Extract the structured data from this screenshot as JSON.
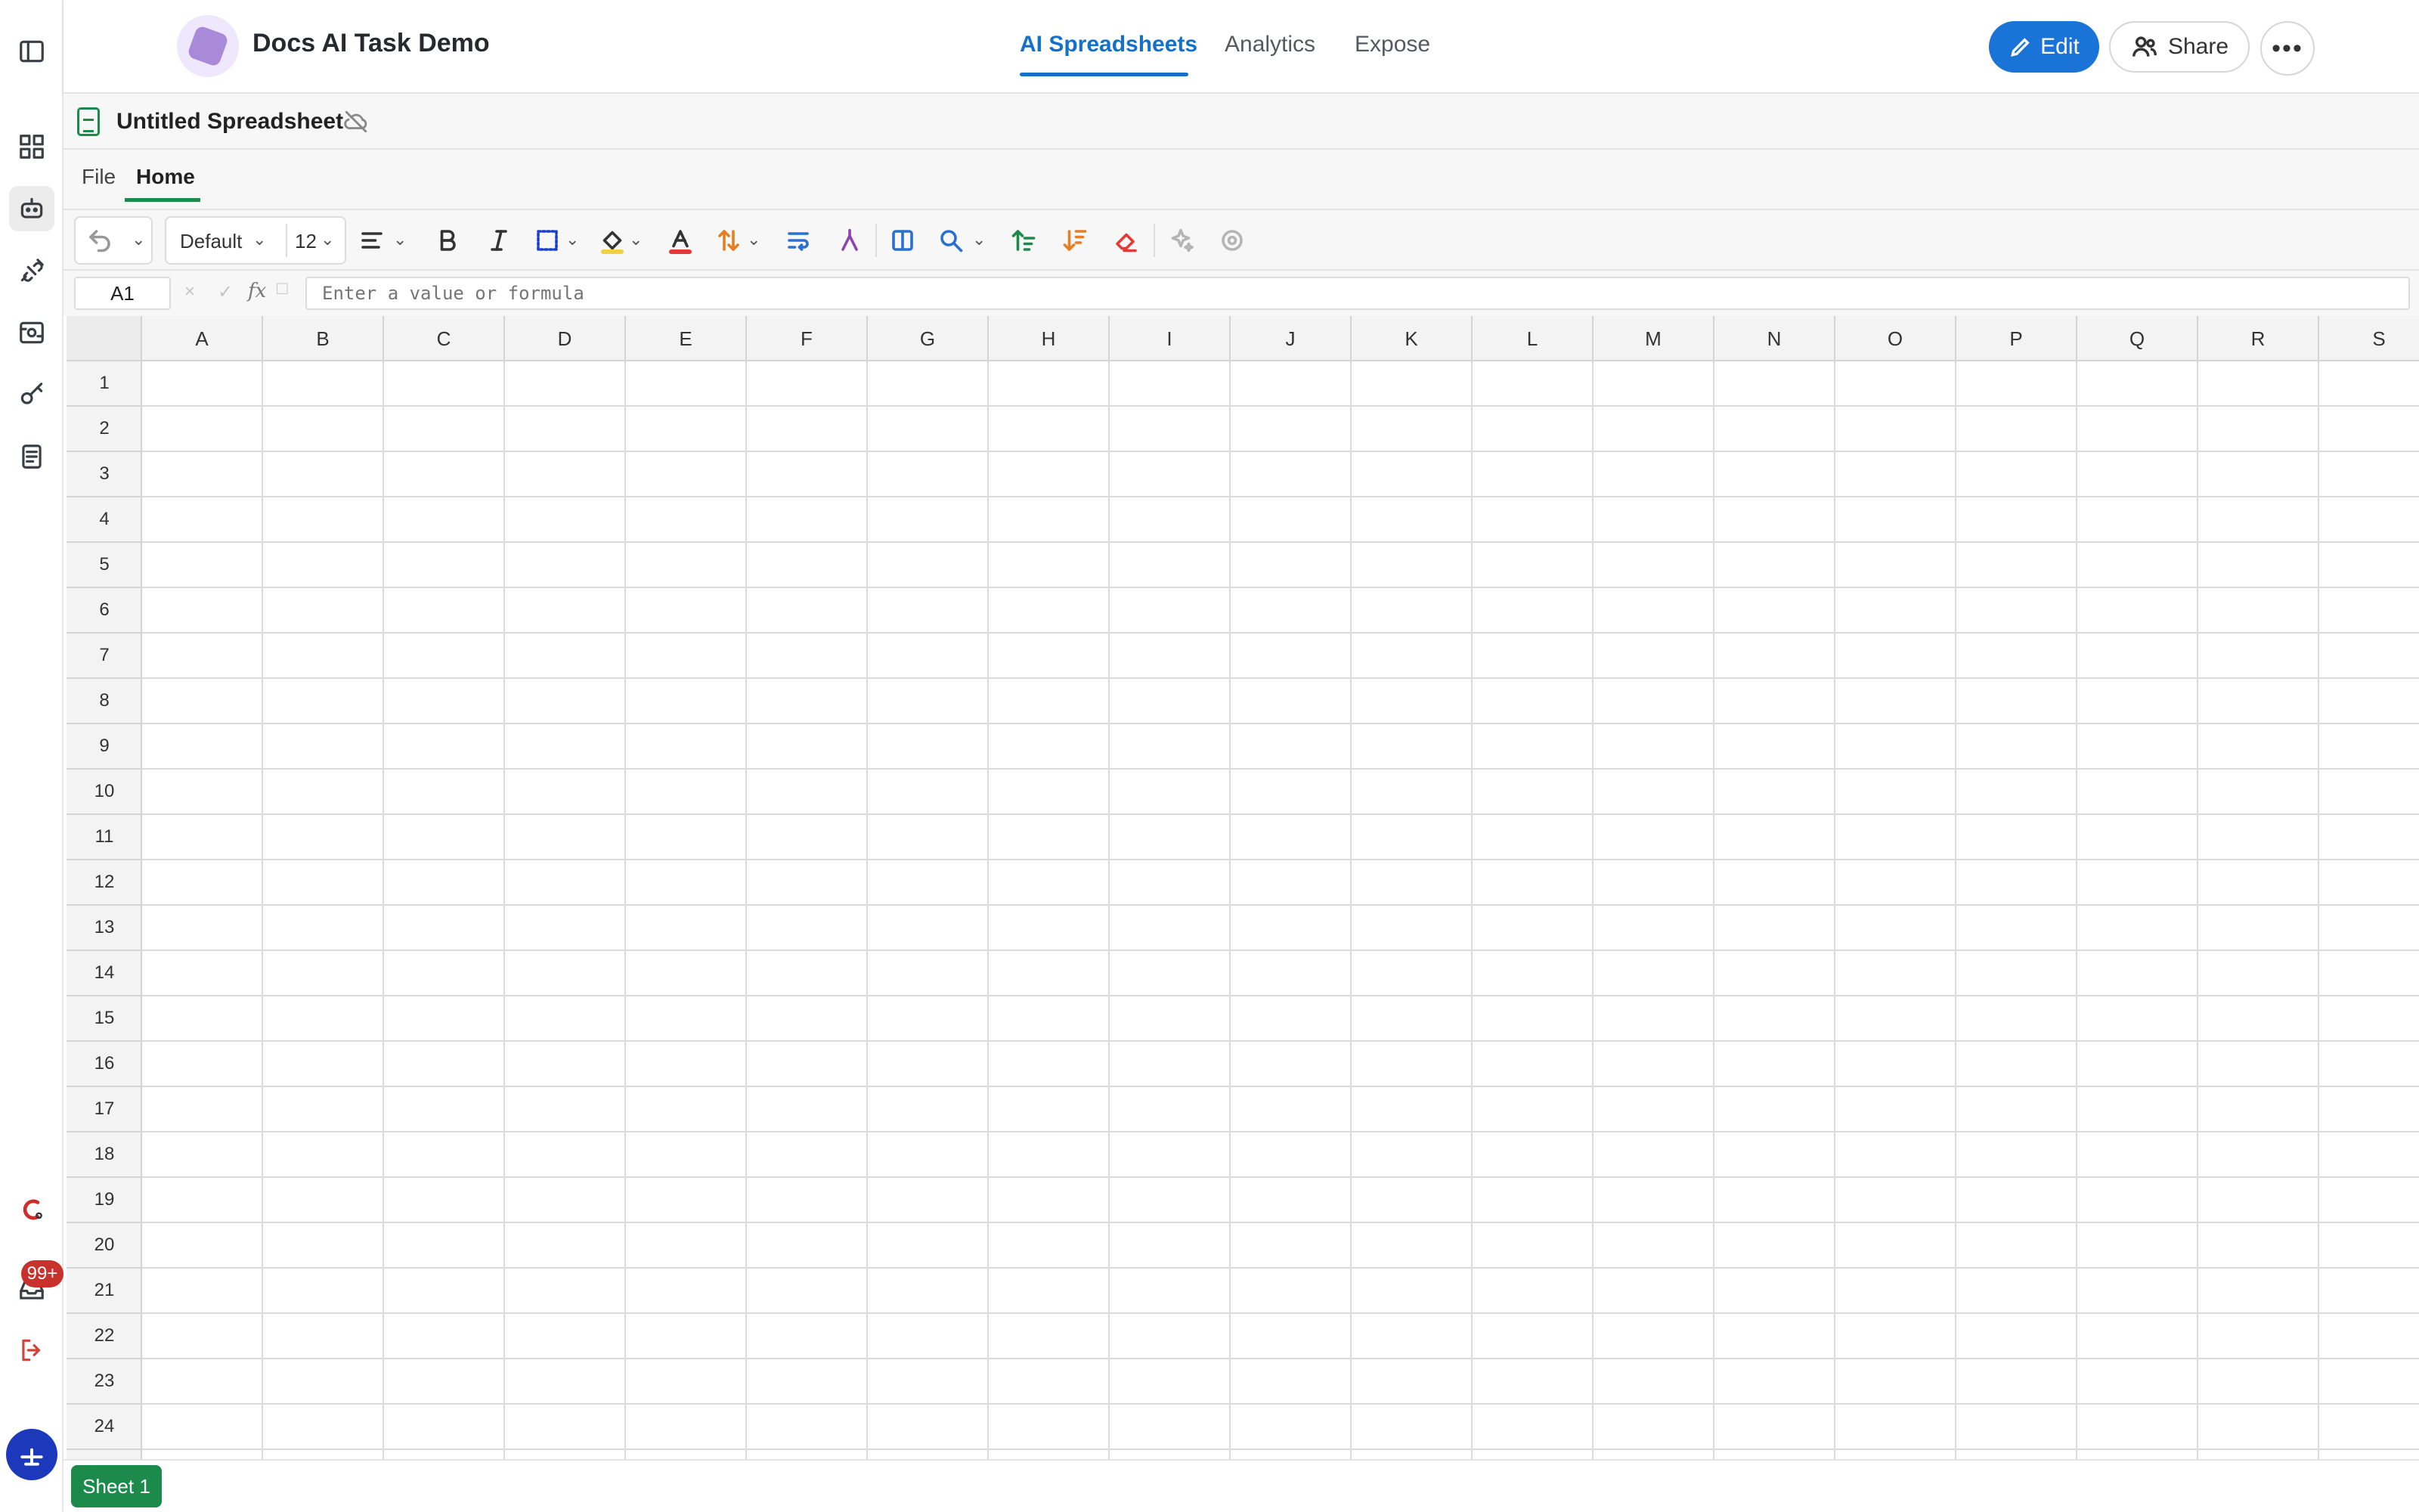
{
  "header": {
    "app_title": "Docs AI Task Demo",
    "tabs": [
      {
        "label": "AI Spreadsheets",
        "active": true
      },
      {
        "label": "Analytics",
        "active": false
      },
      {
        "label": "Expose",
        "active": false
      }
    ],
    "edit_label": "Edit",
    "share_label": "Share",
    "more_label": "•••"
  },
  "sidebar": {
    "items": [
      {
        "icon": "sidebar-toggle-icon"
      },
      {
        "icon": "dashboard-grid-icon"
      },
      {
        "icon": "robot-icon",
        "active": true
      },
      {
        "icon": "plug-icon"
      },
      {
        "icon": "scan-icon"
      },
      {
        "icon": "key-icon"
      },
      {
        "icon": "document-icon"
      },
      {
        "icon": "app-logo-icon"
      },
      {
        "icon": "inbox-icon"
      },
      {
        "icon": "logout-icon"
      },
      {
        "icon": "user-avatar-icon"
      }
    ],
    "inbox_badge": "99+"
  },
  "document": {
    "title": "Untitled Spreadsheet"
  },
  "menu": {
    "items": [
      "File",
      "Home"
    ],
    "active": "Home"
  },
  "toolbar": {
    "font": "Default",
    "font_size": "12"
  },
  "formula_bar": {
    "cell_ref": "A1",
    "cancel_mark": "×",
    "confirm_mark": "✓",
    "fx_label": "fx",
    "placeholder": "Enter a value or formula"
  },
  "grid": {
    "columns": [
      "A",
      "B",
      "C",
      "D",
      "E",
      "F",
      "G",
      "H",
      "I",
      "J",
      "K",
      "L",
      "M",
      "N",
      "O",
      "P",
      "Q",
      "R",
      "S"
    ],
    "rows": [
      "1",
      "2",
      "3",
      "4",
      "5",
      "6",
      "7",
      "8",
      "9",
      "10",
      "11",
      "12",
      "13",
      "14",
      "15",
      "16",
      "17",
      "18",
      "19",
      "20",
      "21",
      "22",
      "23",
      "24"
    ]
  },
  "sheets": [
    {
      "label": "Sheet 1",
      "active": true
    }
  ],
  "colors": {
    "accent_blue": "#1a73d6",
    "sheet_green": "#1b8a4a",
    "badge_red": "#c8322c"
  }
}
